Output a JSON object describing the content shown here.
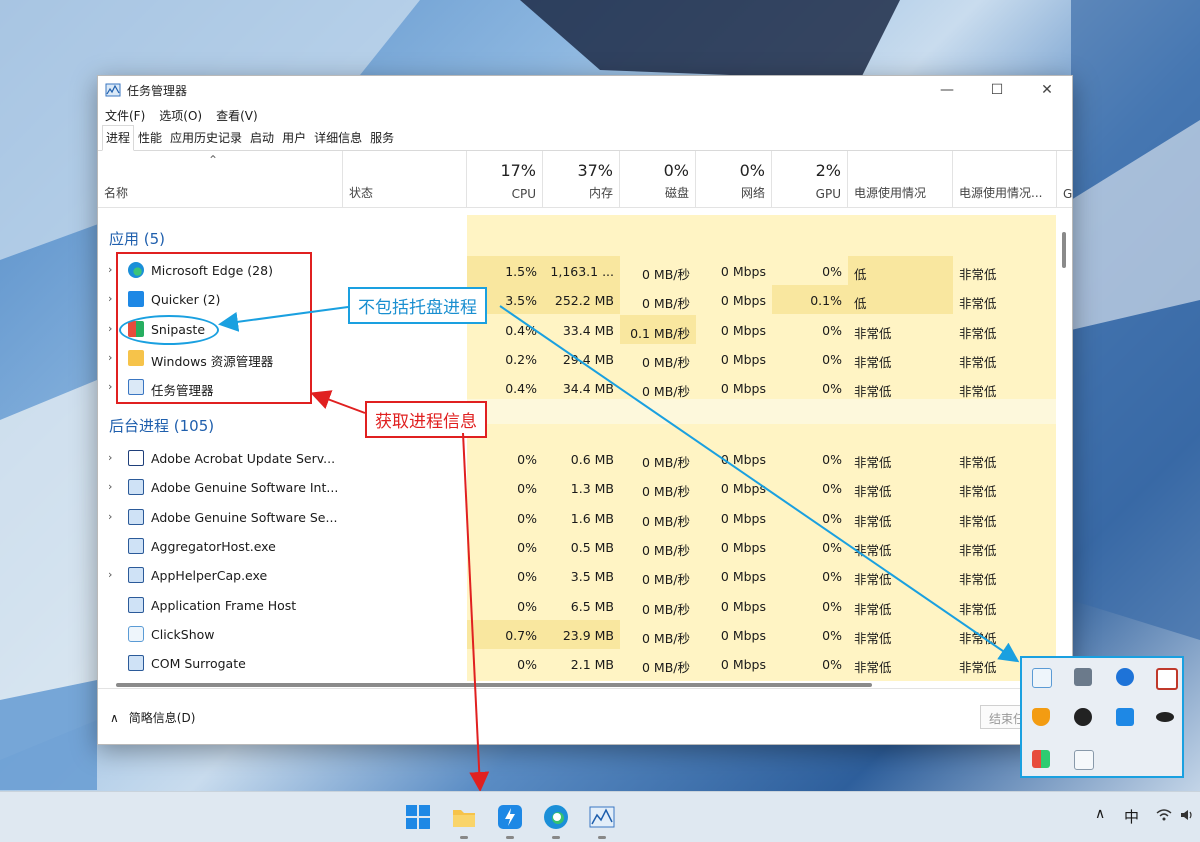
{
  "window": {
    "title": "任务管理器",
    "menu": [
      "文件(F)",
      "选项(O)",
      "查看(V)"
    ],
    "tabs": [
      "进程",
      "性能",
      "应用历史记录",
      "启动",
      "用户",
      "详细信息",
      "服务"
    ],
    "controls": {
      "minimize": "—",
      "maximize": "☐",
      "close": "✕"
    }
  },
  "header": {
    "sort_arrow": "⌃",
    "name": "名称",
    "status": "状态",
    "cpu": {
      "pct": "17%",
      "label": "CPU"
    },
    "memory": {
      "pct": "37%",
      "label": "内存"
    },
    "disk": {
      "pct": "0%",
      "label": "磁盘"
    },
    "network": {
      "pct": "0%",
      "label": "网络"
    },
    "gpu": {
      "pct": "2%",
      "label": "GPU"
    },
    "power": "电源使用情况",
    "power_trend": "电源使用情况...",
    "gpu_engine": "G"
  },
  "groups": {
    "apps": "应用 (5)",
    "background": "后台进程 (105)"
  },
  "apps": [
    {
      "name": "Microsoft Edge (28)",
      "cpu": "1.5%",
      "mem": "1,163.1 ...",
      "disk": "0 MB/秒",
      "net": "0 Mbps",
      "gpu": "0%",
      "power": "低",
      "trend": "非常低",
      "icon": "edge-icon",
      "expand": "›"
    },
    {
      "name": "Quicker (2)",
      "cpu": "3.5%",
      "mem": "252.2 MB",
      "disk": "0 MB/秒",
      "net": "0 Mbps",
      "gpu": "0.1%",
      "power": "低",
      "trend": "非常低",
      "icon": "quicker-icon",
      "expand": "›"
    },
    {
      "name": "Snipaste",
      "cpu": "0.4%",
      "mem": "33.4 MB",
      "disk": "0.1 MB/秒",
      "net": "0 Mbps",
      "gpu": "0%",
      "power": "非常低",
      "trend": "非常低",
      "icon": "snipaste-icon",
      "expand": "›"
    },
    {
      "name": "Windows 资源管理器",
      "cpu": "0.2%",
      "mem": "29.4 MB",
      "disk": "0 MB/秒",
      "net": "0 Mbps",
      "gpu": "0%",
      "power": "非常低",
      "trend": "非常低",
      "icon": "folder-icon",
      "expand": "›"
    },
    {
      "name": "任务管理器",
      "cpu": "0.4%",
      "mem": "34.4 MB",
      "disk": "0 MB/秒",
      "net": "0 Mbps",
      "gpu": "0%",
      "power": "非常低",
      "trend": "非常低",
      "icon": "taskmgr-icon",
      "expand": "›"
    }
  ],
  "background": [
    {
      "name": "Adobe Acrobat Update Serv...",
      "cpu": "0%",
      "mem": "0.6 MB",
      "disk": "0 MB/秒",
      "net": "0 Mbps",
      "gpu": "0%",
      "power": "非常低",
      "trend": "非常低",
      "icon": "window-icon",
      "expand": "›"
    },
    {
      "name": "Adobe Genuine Software Int...",
      "cpu": "0%",
      "mem": "1.3 MB",
      "disk": "0 MB/秒",
      "net": "0 Mbps",
      "gpu": "0%",
      "power": "非常低",
      "trend": "非常低",
      "icon": "service-icon",
      "expand": "›"
    },
    {
      "name": "Adobe Genuine Software Se...",
      "cpu": "0%",
      "mem": "1.6 MB",
      "disk": "0 MB/秒",
      "net": "0 Mbps",
      "gpu": "0%",
      "power": "非常低",
      "trend": "非常低",
      "icon": "service-icon",
      "expand": "›"
    },
    {
      "name": "AggregatorHost.exe",
      "cpu": "0%",
      "mem": "0.5 MB",
      "disk": "0 MB/秒",
      "net": "0 Mbps",
      "gpu": "0%",
      "power": "非常低",
      "trend": "非常低",
      "icon": "service-icon",
      "expand": ""
    },
    {
      "name": "AppHelperCap.exe",
      "cpu": "0%",
      "mem": "3.5 MB",
      "disk": "0 MB/秒",
      "net": "0 Mbps",
      "gpu": "0%",
      "power": "非常低",
      "trend": "非常低",
      "icon": "service-icon",
      "expand": "›"
    },
    {
      "name": "Application Frame Host",
      "cpu": "0%",
      "mem": "6.5 MB",
      "disk": "0 MB/秒",
      "net": "0 Mbps",
      "gpu": "0%",
      "power": "非常低",
      "trend": "非常低",
      "icon": "service-icon",
      "expand": ""
    },
    {
      "name": "ClickShow",
      "cpu": "0.7%",
      "mem": "23.9 MB",
      "disk": "0 MB/秒",
      "net": "0 Mbps",
      "gpu": "0%",
      "power": "非常低",
      "trend": "非常低",
      "icon": "clickshow-icon",
      "expand": ""
    },
    {
      "name": "COM Surrogate",
      "cpu": "0%",
      "mem": "2.1 MB",
      "disk": "0 MB/秒",
      "net": "0 Mbps",
      "gpu": "0%",
      "power": "非常低",
      "trend": "非常低",
      "icon": "service-icon",
      "expand": ""
    }
  ],
  "footer": {
    "chevron": "∧",
    "summary": "简略信息(D)",
    "end_task": "结束任务"
  },
  "annotations": {
    "tray_note": "不包括托盘进程",
    "get_info": "获取进程信息"
  },
  "tray": {
    "up_arrow": "∧",
    "ime": "中",
    "wifi": "wifi",
    "volume": "volume"
  },
  "colors": {
    "accent": "#1f5fad",
    "highlight": "#f9e79f",
    "annotation_red": "#e02020",
    "annotation_blue": "#1aa0e0"
  }
}
